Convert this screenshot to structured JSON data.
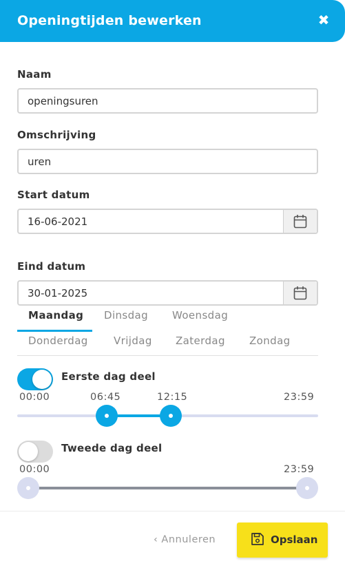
{
  "header": {
    "title": "Openingtijden bewerken",
    "close_glyph": "✖"
  },
  "form": {
    "name_label": "Naam",
    "name_value": "openingsuren",
    "description_label": "Omschrijving",
    "description_value": "uren",
    "start_label": "Start datum",
    "start_value": "16-06-2021",
    "end_label": "Eind datum",
    "end_value": "30-01-2025"
  },
  "days": {
    "tabs": [
      "Maandag",
      "Dinsdag",
      "Woensdag",
      "Donderdag",
      "Vrijdag",
      "Zaterdag",
      "Zondag"
    ],
    "active": "Maandag"
  },
  "part1": {
    "label": "Eerste dag deel",
    "enabled": true,
    "min": "00:00",
    "start": "06:45",
    "end": "12:15",
    "max": "23:59"
  },
  "part2": {
    "label": "Tweede dag deel",
    "enabled": false,
    "min": "00:00",
    "max": "23:59"
  },
  "footer": {
    "cancel_label": "Annuleren",
    "cancel_glyph": "‹",
    "save_label": "Opslaan"
  },
  "colors": {
    "accent": "#0ba7e4",
    "save": "#f7e01a",
    "disabled_handle": "#d8dcf0",
    "disabled_track": "#8a8f99"
  },
  "icons": {
    "close": "close-icon",
    "calendar": "calendar-icon",
    "save": "floppy-disk-icon",
    "back": "chevron-left-icon"
  }
}
